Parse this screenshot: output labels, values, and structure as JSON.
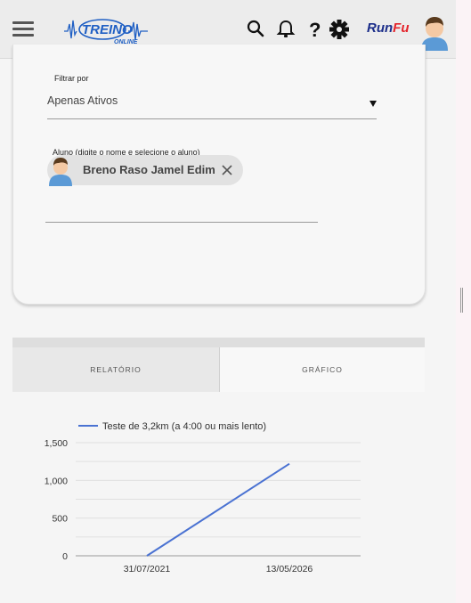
{
  "header": {
    "brand_left": "Run",
    "brand_right": "Fu",
    "logo_text": "TREINO",
    "logo_subtext": "ONLINE",
    "icons": [
      "menu-icon",
      "search-icon",
      "bell-icon",
      "help-icon",
      "gear-icon",
      "avatar"
    ]
  },
  "filter": {
    "label": "Filtrar por",
    "value": "Apenas Ativos"
  },
  "student": {
    "label": "Aluno (digite o nome e selecione o aluno)",
    "chip_name": "Breno Raso Jamel Edim",
    "chip_close": "✕"
  },
  "tabs": [
    {
      "label": "RELATÓRIO",
      "active": false
    },
    {
      "label": "GRÁFICO",
      "active": true
    }
  ],
  "chart_data": {
    "type": "line",
    "legend": "Teste de 3,2km (a 4:00 ou mais lento)",
    "x_labels": [
      "31/07/2021",
      "13/05/2026"
    ],
    "y_ticks": [
      "0",
      "500",
      "1,000",
      "1,500"
    ],
    "ylim": [
      0,
      1500
    ],
    "series": [
      {
        "name": "Teste de 3,2km (a 4:00 ou mais lento)",
        "points": [
          [
            "31/07/2021",
            0
          ],
          [
            "13/05/2026",
            1220
          ]
        ]
      }
    ],
    "color": "#4a72d2",
    "grid": true,
    "legend_position": "top"
  }
}
